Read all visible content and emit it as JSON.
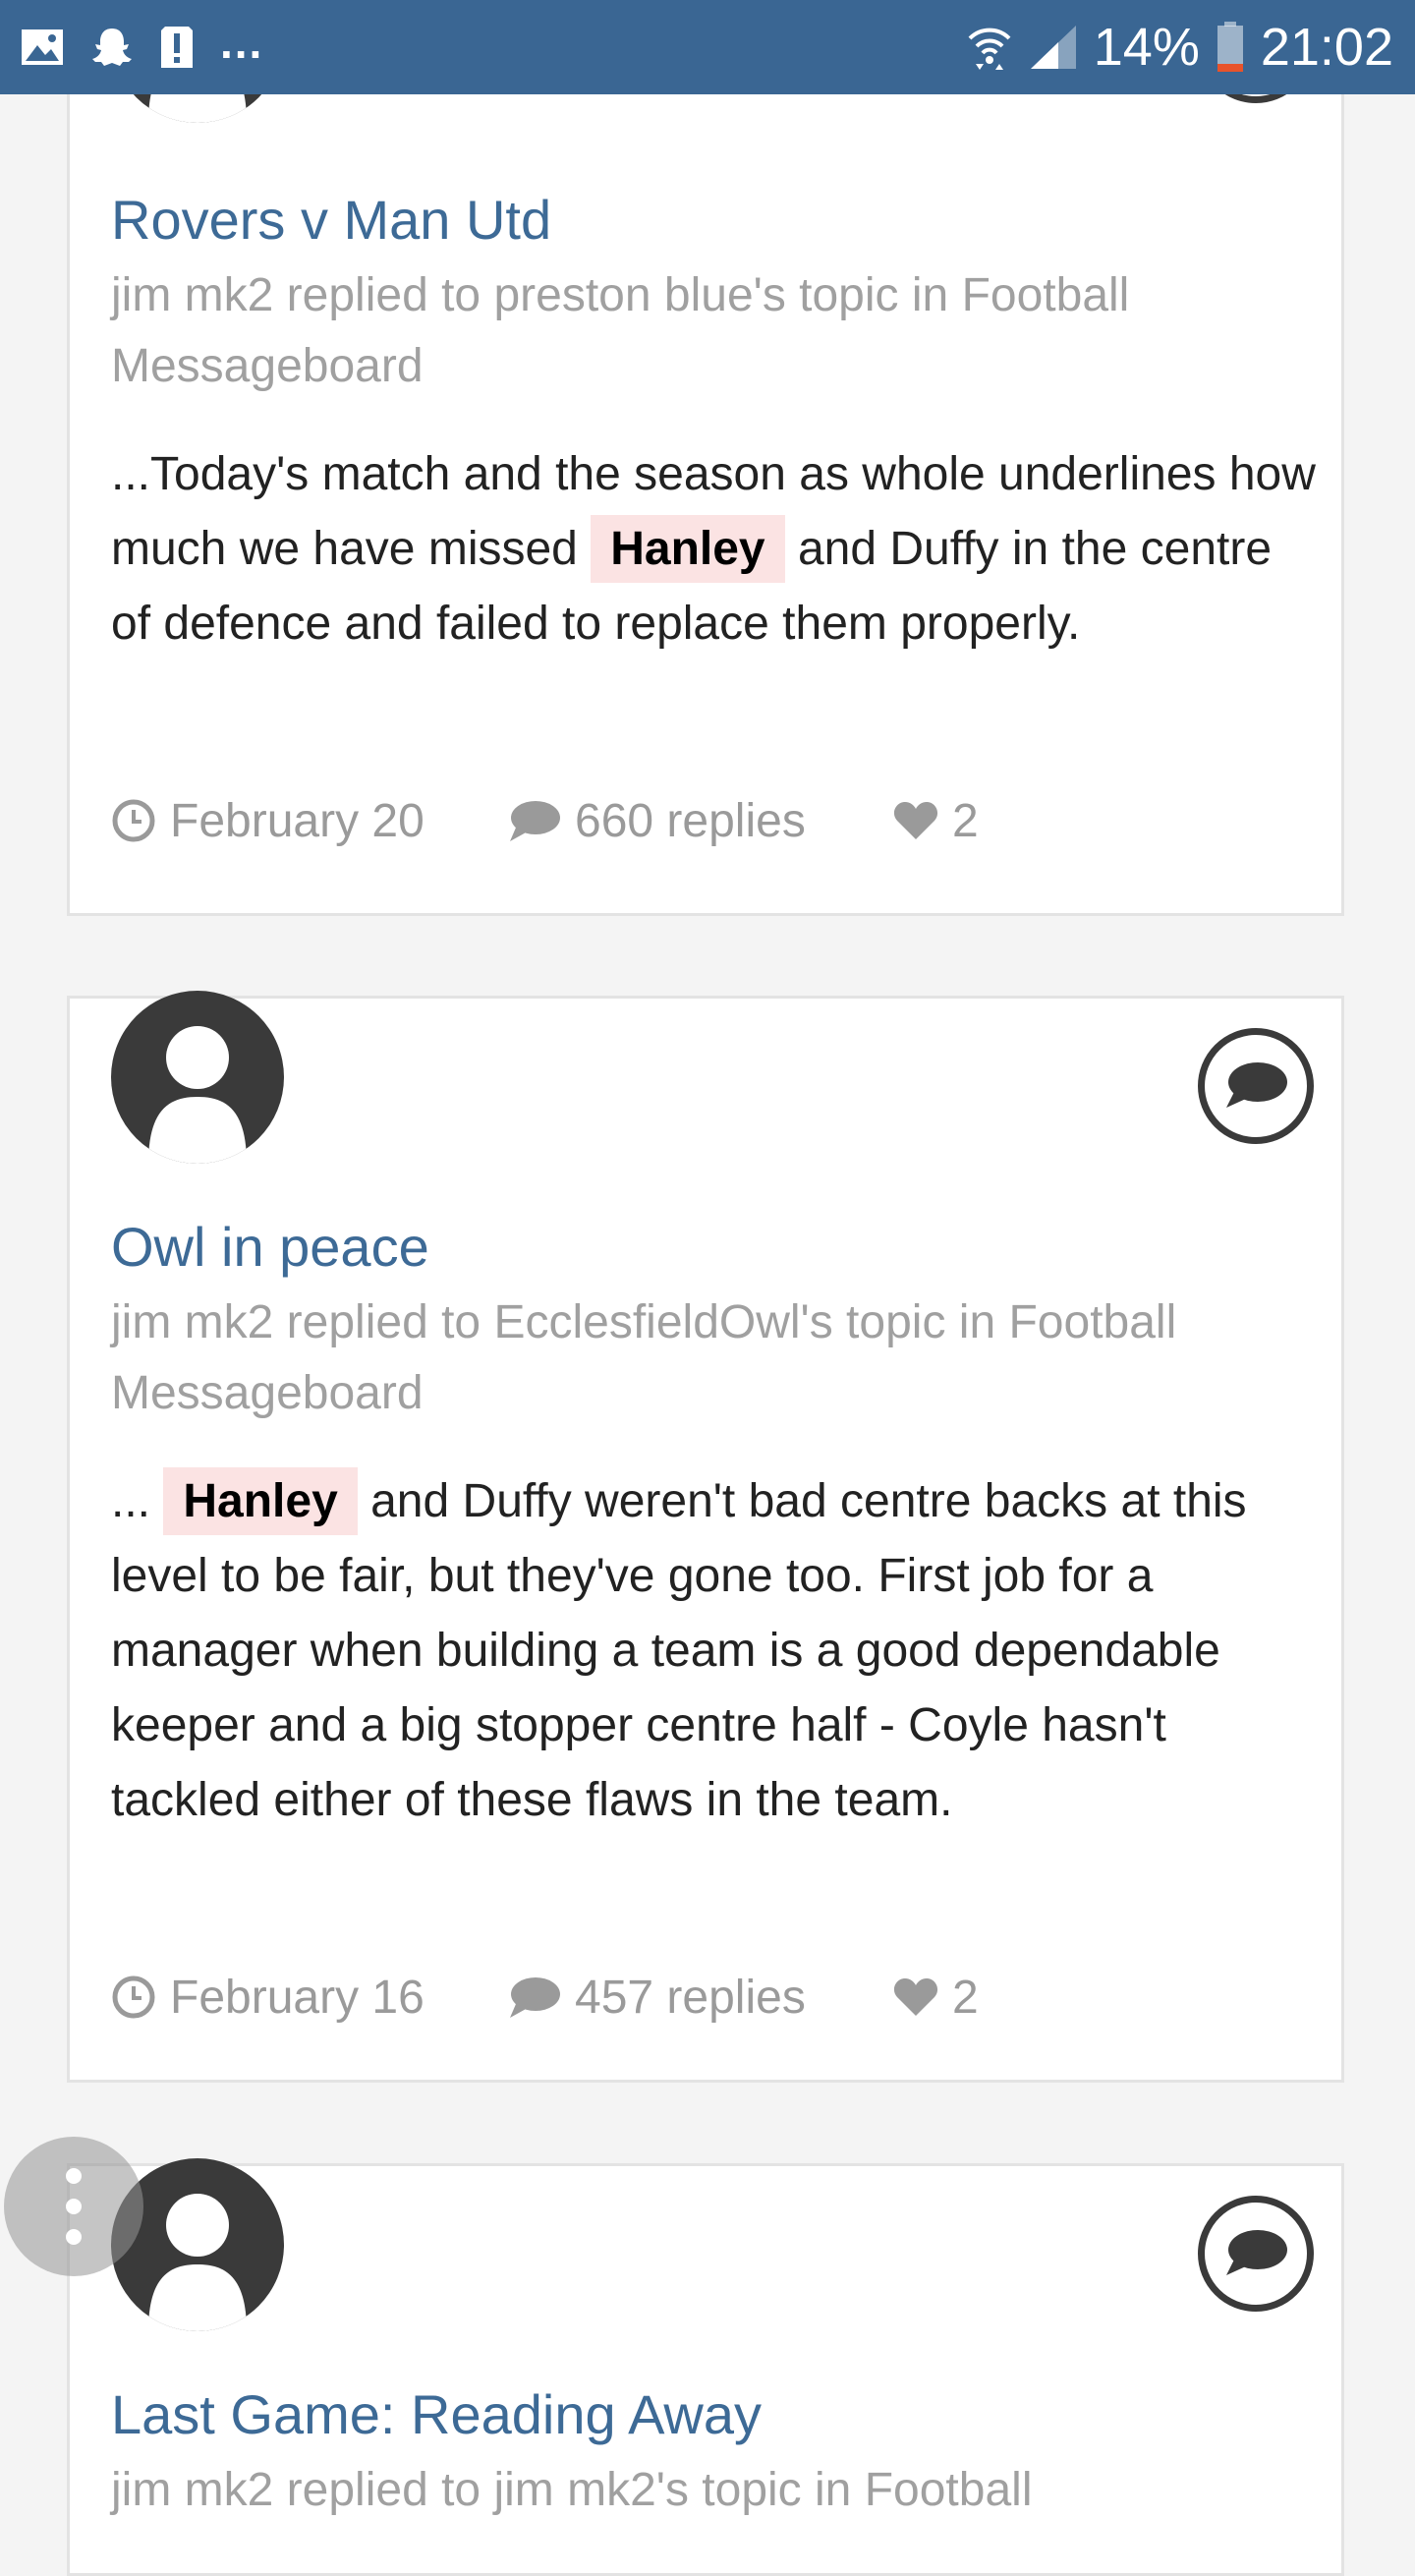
{
  "statusbar": {
    "notifications": [
      "image-icon",
      "snapchat-icon",
      "alert-icon"
    ],
    "more": "...",
    "battery": "14%",
    "time": "21:02"
  },
  "posts": [
    {
      "title": "Rovers v Man Utd",
      "meta": "jim mk2 replied to preston blue's topic in Football Messageboard",
      "snippet_before": "...Today's match and the season as whole underlines how much we have missed",
      "highlight": "Hanley",
      "snippet_after": "and Duffy in the centre of defence and failed to replace them properly.",
      "date": "February 20",
      "replies": "660 replies",
      "likes": "2"
    },
    {
      "title": "Owl in peace",
      "meta": "jim mk2 replied to EcclesfieldOwl's topic in Football Messageboard",
      "snippet_before": "...",
      "highlight": "Hanley",
      "snippet_after": "and Duffy weren't bad centre backs at this level to be fair, but they've gone too. First job for a manager when building a team is a good dependable keeper and a big stopper centre half - Coyle hasn't tackled either of these flaws in the team.",
      "date": "February 16",
      "replies": "457 replies",
      "likes": "2"
    },
    {
      "title": "Last Game: Reading Away",
      "meta": "jim mk2 replied to jim mk2's topic in Football"
    }
  ],
  "colors": {
    "statusbar": "#3a6693",
    "link": "#3d6a96",
    "highlight_bg": "#fbe3e3",
    "muted": "#a0a0a0"
  }
}
